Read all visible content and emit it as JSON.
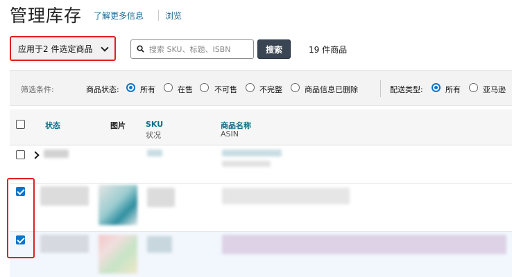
{
  "header": {
    "title": "管理库存",
    "learn_more": "了解更多信息",
    "browse": "浏览"
  },
  "toolbar": {
    "bulk_action_label": "应用于2 件选定商品",
    "search_placeholder": "搜索 SKU、标题、ISBN",
    "search_button": "搜索",
    "item_count": "19 件商品"
  },
  "filters": {
    "label": "筛选条件:",
    "product_status_label": "商品状态:",
    "product_status_options": [
      "所有",
      "在售",
      "不可售",
      "不完整",
      "商品信息已删除"
    ],
    "product_status_selected": "所有",
    "fulfillment_label": "配送类型:",
    "fulfillment_options": [
      "所有",
      "亚马逊"
    ],
    "fulfillment_selected": "所有"
  },
  "table": {
    "columns": {
      "status": "状态",
      "image": "图片",
      "sku": "SKU",
      "condition": "状况",
      "product_name": "商品名称",
      "asin": "ASIN"
    },
    "rows": [
      {
        "checked": false
      },
      {
        "checked": true
      },
      {
        "checked": true
      }
    ]
  },
  "colors": {
    "accent_blue": "#0b74c9",
    "link_teal": "#0f6e88",
    "highlight_red": "#e02020",
    "search_button_bg": "#3a4553"
  },
  "icons": {
    "search": "search-icon",
    "dropdown": "chevron-down-icon",
    "expand": "chevron-right-icon"
  }
}
